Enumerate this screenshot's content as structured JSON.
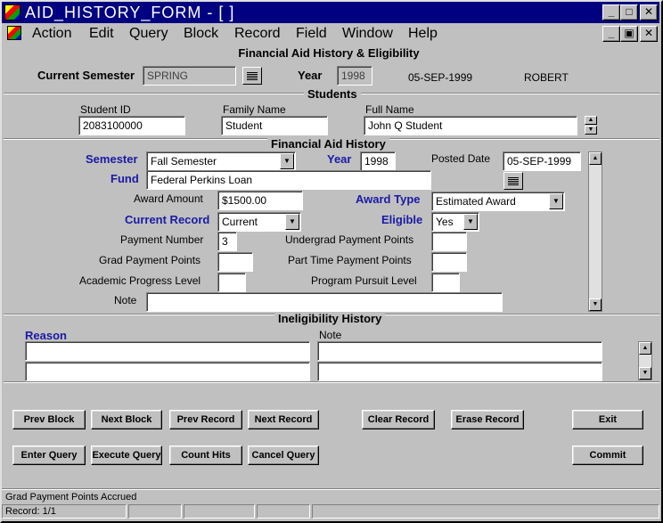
{
  "window": {
    "title": "AID_HISTORY_FORM - [ ]"
  },
  "menu": [
    "Action",
    "Edit",
    "Query",
    "Block",
    "Record",
    "Field",
    "Window",
    "Help"
  ],
  "form_title": "Financial Aid History & Eligibility",
  "header": {
    "current_semester_label": "Current Semester",
    "current_semester_value": "SPRING",
    "year_label": "Year",
    "year_value": "1998",
    "date": "05-SEP-1999",
    "user": "ROBERT"
  },
  "students": {
    "section_title": "Students",
    "student_id_label": "Student ID",
    "student_id_value": "2083100000",
    "family_name_label": "Family Name",
    "family_name_value": "Student",
    "full_name_label": "Full Name",
    "full_name_value": "John Q Student"
  },
  "history": {
    "section_title": "Financial Aid History",
    "semester_label": "Semester",
    "semester_value": "Fall Semester",
    "year_label": "Year",
    "year_value": "1998",
    "posted_date_label": "Posted Date",
    "posted_date_value": "05-SEP-1999",
    "fund_label": "Fund",
    "fund_value": "Federal Perkins Loan",
    "award_amount_label": "Award Amount",
    "award_amount_value": "$1500.00",
    "award_type_label": "Award Type",
    "award_type_value": "Estimated Award",
    "current_record_label": "Current Record",
    "current_record_value": "Current",
    "eligible_label": "Eligible",
    "eligible_value": "Yes",
    "payment_number_label": "Payment Number",
    "payment_number_value": "3",
    "undergrad_points_label": "Undergrad Payment Points",
    "undergrad_points_value": "",
    "grad_points_label": "Grad Payment Points",
    "grad_points_value": "",
    "part_time_points_label": "Part Time Payment Points",
    "part_time_points_value": "",
    "academic_progress_label": "Academic Progress Level",
    "academic_progress_value": "",
    "program_pursuit_label": "Program Pursuit Level",
    "program_pursuit_value": "",
    "note_label": "Note",
    "note_value": ""
  },
  "ineligibility": {
    "section_title": "Ineligibility History",
    "reason_label": "Reason",
    "note_label": "Note",
    "rows": [
      {
        "reason": "",
        "note": ""
      },
      {
        "reason": "",
        "note": ""
      }
    ]
  },
  "buttons": {
    "prev_block": "Prev Block",
    "next_block": "Next Block",
    "prev_record": "Prev Record",
    "next_record": "Next Record",
    "clear_record": "Clear Record",
    "erase_record": "Erase Record",
    "exit": "Exit",
    "enter_query": "Enter Query",
    "execute_query": "Execute Query",
    "count_hits": "Count Hits",
    "cancel_query": "Cancel Query",
    "commit": "Commit"
  },
  "status": {
    "hint": "Grad Payment Points Accrued",
    "record": "Record: 1/1"
  },
  "colors": {
    "titlebar": "#000080",
    "label_accent": "#1a1aa6",
    "background": "#c0c0c0"
  }
}
